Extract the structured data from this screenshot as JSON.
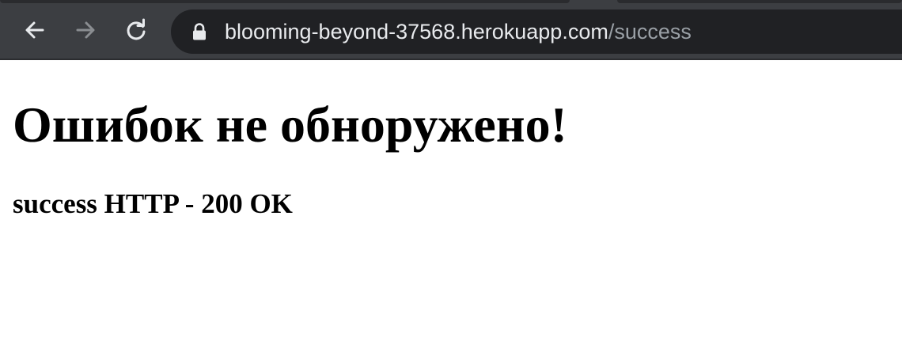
{
  "browser": {
    "url_host": "blooming-beyond-37568.herokuapp.com",
    "url_path": "/success",
    "icons": {
      "back": "arrow-left-icon",
      "forward": "arrow-right-icon",
      "reload": "reload-icon",
      "lock": "lock-icon"
    },
    "colors": {
      "toolbar": "#3c3e42",
      "omnibox": "#202124",
      "url_host": "#e8eaed",
      "url_path": "#9aa0a6"
    }
  },
  "page": {
    "heading": "Ошибок не обноружено!",
    "status_text": "success HTTP - 200 OK"
  }
}
